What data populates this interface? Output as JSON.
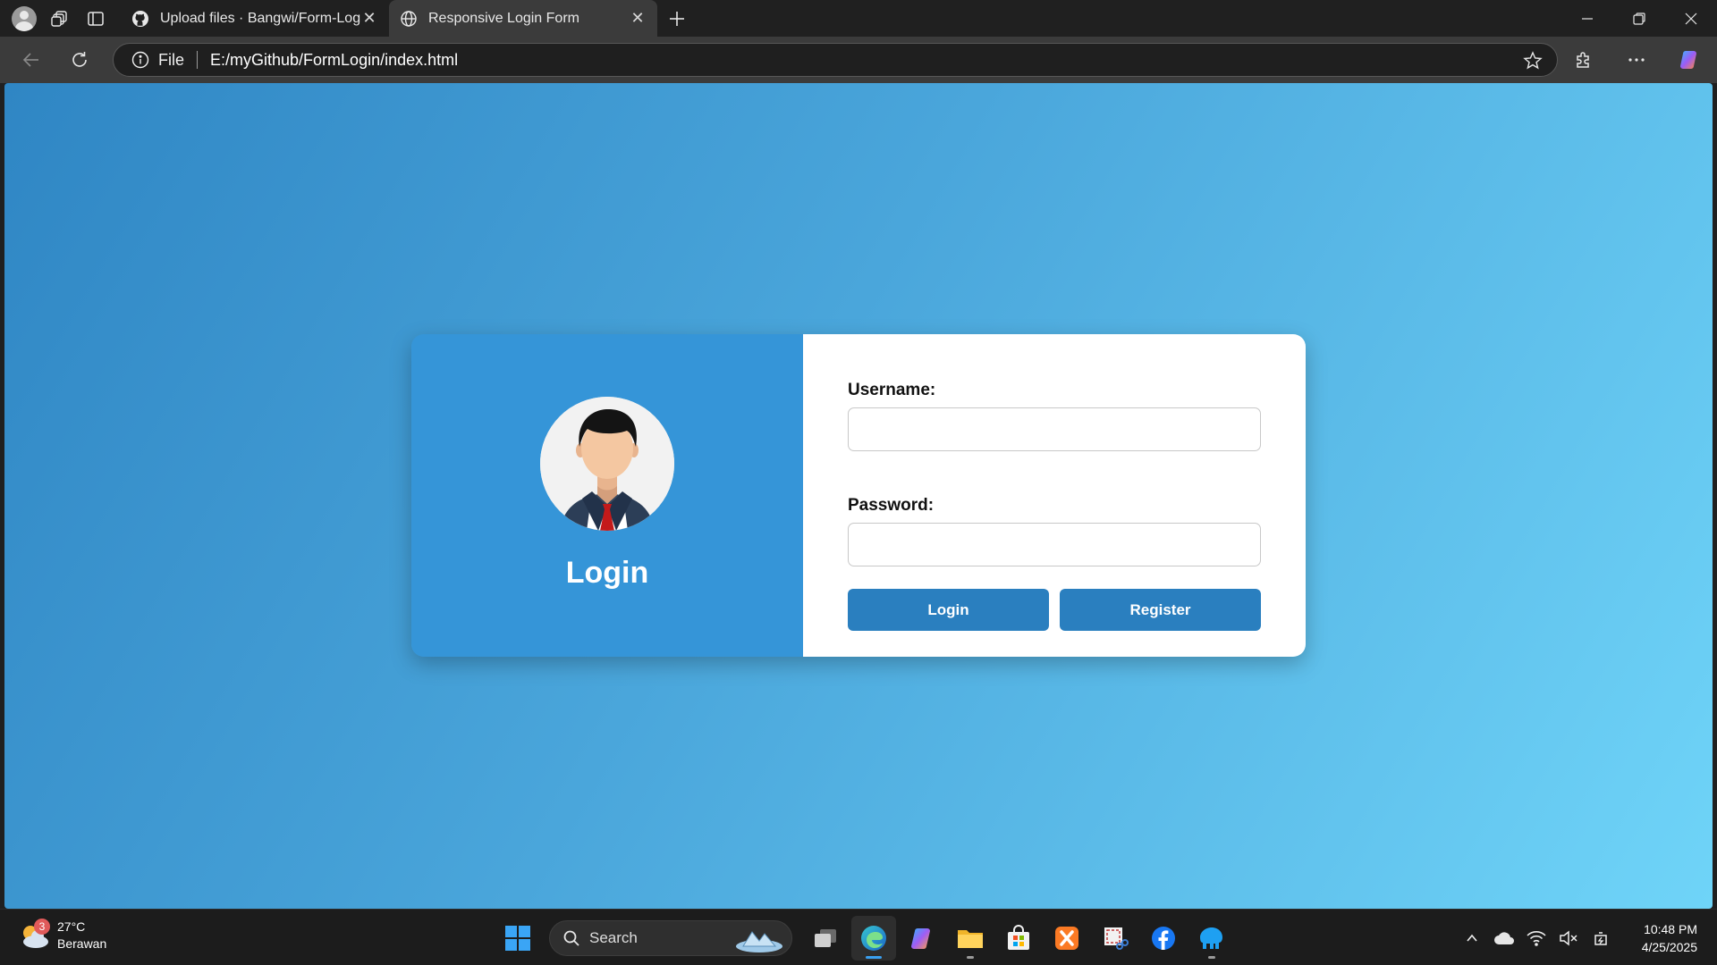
{
  "browser": {
    "tabs": [
      {
        "title": "Upload files · Bangwi/Form-Login",
        "active": false,
        "favicon": "github-icon"
      },
      {
        "title": "Responsive Login Form",
        "active": true,
        "favicon": "globe-icon"
      }
    ],
    "address": {
      "scheme_label": "File",
      "url": "E:/myGithub/FormLogin/index.html"
    }
  },
  "page": {
    "card_title": "Login",
    "username_label": "Username:",
    "username_value": "",
    "password_label": "Password:",
    "password_value": "",
    "login_button": "Login",
    "register_button": "Register",
    "colors": {
      "gradient_start": "#2f86c4",
      "gradient_end": "#6fd4f8",
      "left_panel": "#3595d8",
      "button": "#2a7fbf"
    }
  },
  "taskbar": {
    "weather": {
      "badge": "3",
      "temperature": "27°C",
      "condition": "Berawan"
    },
    "search_placeholder": "Search",
    "apps": [
      "task-view-icon",
      "edge-icon",
      "copilot-icon",
      "file-explorer-icon",
      "store-icon",
      "xampp-icon",
      "snipping-tool-icon",
      "facebook-icon",
      "app-icon"
    ],
    "clock": {
      "time": "10:48 PM",
      "date": "4/25/2025"
    }
  }
}
